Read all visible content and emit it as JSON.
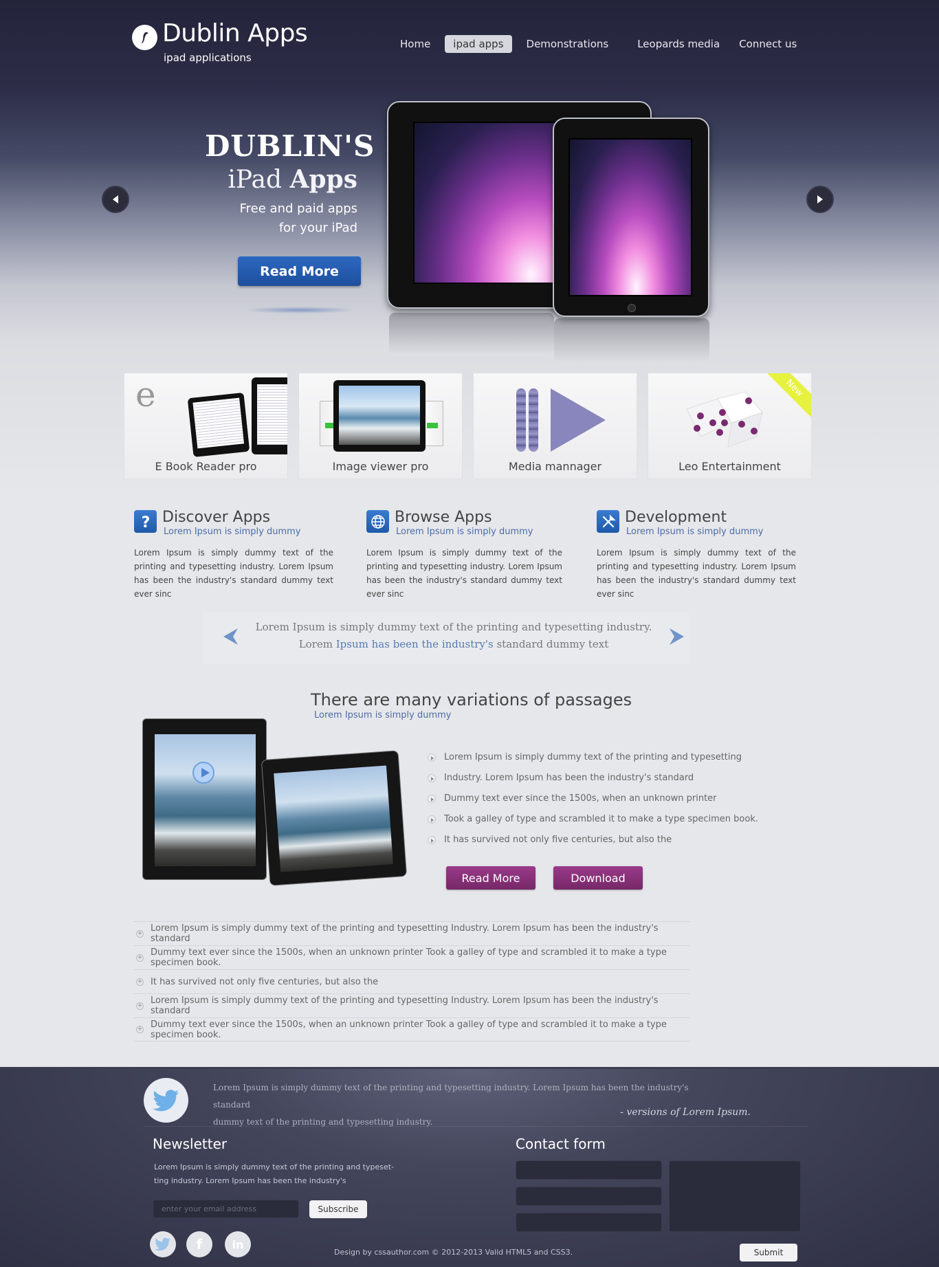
{
  "header": {
    "logo_title": "Dublin Apps",
    "logo_subtitle": "ipad applications",
    "nav": [
      {
        "label": "Home"
      },
      {
        "label": "ipad apps"
      },
      {
        "label": "Demonstrations"
      },
      {
        "label": "Leopards media"
      },
      {
        "label": "Connect us"
      }
    ],
    "active_nav": "ipad apps"
  },
  "hero": {
    "heading1": "DUBLIN'S",
    "heading2_light": "iPad ",
    "heading2_bold": "Apps",
    "subtitle_line1": "Free and paid apps",
    "subtitle_line2": "for your iPad",
    "button_label": "Read More"
  },
  "apps": [
    {
      "label": "E Book Reader pro",
      "icon": "ebook-icon",
      "letter": "e"
    },
    {
      "label": "Image viewer pro",
      "icon": "image-viewer-icon"
    },
    {
      "label": "Media mannager",
      "icon": "media-icon"
    },
    {
      "label": "Leo Entertainment",
      "icon": "dice-icon",
      "badge": "New"
    }
  ],
  "features": [
    {
      "title": "Discover Apps",
      "subtitle": "Lorem Ipsum is simply dummy",
      "icon": "question-icon",
      "text": "Lorem Ipsum is simply dummy text of the printing and typesetting industry. Lorem Ipsum has been the industry's standard dummy text ever sinc"
    },
    {
      "title": "Browse Apps",
      "subtitle": "Lorem Ipsum is simply dummy",
      "icon": "globe-icon",
      "text": "Lorem Ipsum is simply dummy text of the printing and typesetting industry. Lorem Ipsum has been the industry's standard dummy text ever sinc"
    },
    {
      "title": "Development",
      "subtitle": "Lorem Ipsum is simply dummy",
      "icon": "tools-icon",
      "text": "Lorem Ipsum is simply dummy text of the printing and typesetting industry. Lorem Ipsum has been the industry's standard dummy text ever sinc"
    }
  ],
  "quote_slider": {
    "line1": "Lorem Ipsum is simply dummy text of the printing and typesetting industry.",
    "line2_start": "Lorem ",
    "line2_highlight": "Ipsum has been the industry's",
    "line2_end": " standard dummy text"
  },
  "passages": {
    "title": "There are many variations of passages",
    "subtitle": "Lorem Ipsum is simply dummy",
    "bullets": [
      "Lorem Ipsum is simply dummy text of the printing and typesetting",
      "Industry. Lorem Ipsum has been the industry's standard",
      "Dummy text ever since the 1500s, when an unknown printer",
      "Took a galley of type and scrambled it to make a type specimen book.",
      "It has survived not only five centuries, but also the"
    ],
    "read_more_label": "Read More",
    "download_label": "Download"
  },
  "accordion": [
    "Lorem Ipsum is simply dummy text of the printing and typesetting Industry. Lorem Ipsum has been the industry's standard",
    "Dummy text ever since the 1500s, when an unknown printer Took a galley of type and scrambled it to make a type specimen book.",
    "It has survived not only five centuries, but also the",
    "Lorem Ipsum is simply dummy text of the printing and typesetting Industry. Lorem Ipsum has been the industry's standard",
    "Dummy text ever since the 1500s, when an unknown printer Took a galley of type and scrambled it to make a type specimen book."
  ],
  "footer": {
    "tweet_line1": "Lorem Ipsum is simply dummy text of the printing and typesetting industry. Lorem Ipsum has been the industry's standard",
    "tweet_line2": "dummy text  of the printing and typesetting industry.",
    "tweet_author": "- versions of Lorem Ipsum.",
    "newsletter_title": "Newsletter",
    "newsletter_text_line1": "Lorem Ipsum is simply dummy text of the printing and typeset-",
    "newsletter_text_line2": "ting industry. Lorem Ipsum has been the industry's",
    "email_placeholder": "enter your email address",
    "subscribe_label": "Subscribe",
    "contact_title": "Contact form",
    "submit_label": "Submit",
    "copyright": "Design by cssauthor.com © 2012-2013  Valid HTML5 and CSS3.",
    "social": [
      "twitter-icon",
      "facebook-icon",
      "linkedin-icon"
    ]
  },
  "colors": {
    "accent_blue": "#1e4f9c",
    "accent_purple": "#762868",
    "link_blue": "#4c6ca8",
    "footer_bg": "#2f3044"
  }
}
